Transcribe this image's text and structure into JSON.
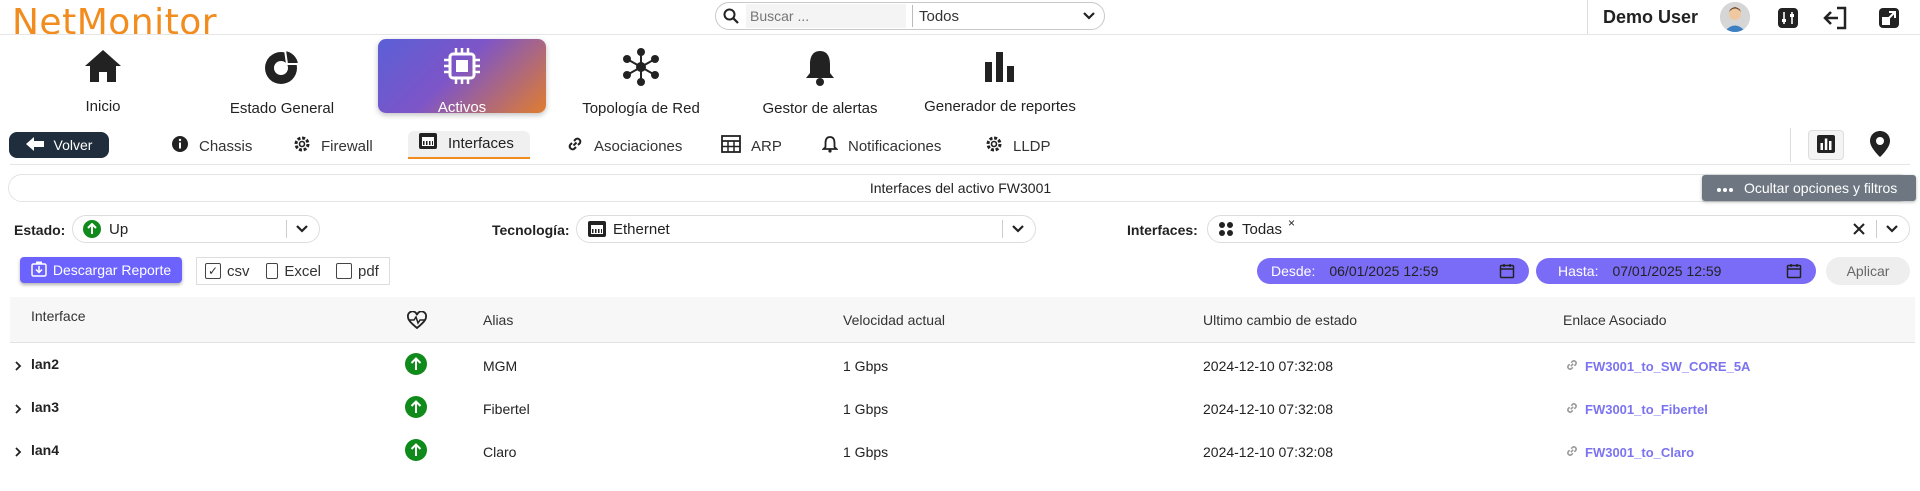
{
  "app": {
    "logo": "NetMonitor"
  },
  "search": {
    "placeholder": "Buscar ...",
    "scope": "Todos"
  },
  "user": {
    "name": "Demo User"
  },
  "nav": [
    {
      "label": "Inicio",
      "icon": "home-icon"
    },
    {
      "label": "Estado General",
      "icon": "pie-chart-icon"
    },
    {
      "label": "Activos",
      "icon": "cpu-chip-icon",
      "active": true
    },
    {
      "label": "Topología de Red",
      "icon": "network-topology-icon"
    },
    {
      "label": "Gestor de alertas",
      "icon": "bell-icon"
    },
    {
      "label": "Generador de reportes",
      "icon": "bar-chart-icon"
    }
  ],
  "subnav": {
    "back": "Volver",
    "tabs": [
      {
        "label": "Chassis",
        "icon": "info-icon"
      },
      {
        "label": "Firewall",
        "icon": "gear-icon"
      },
      {
        "label": "Interfaces",
        "icon": "ethernet-port-icon",
        "active": true
      },
      {
        "label": "Asociaciones",
        "icon": "link-icon"
      },
      {
        "label": "ARP",
        "icon": "table-icon"
      },
      {
        "label": "Notificaciones",
        "icon": "bell-icon"
      },
      {
        "label": "LLDP",
        "icon": "gear-icon"
      }
    ]
  },
  "title": "Interfaces del activo FW3001",
  "toggle_filters": "Ocultar opciones y filtros",
  "filters": {
    "estado_label": "Estado:",
    "estado_value": "Up",
    "tecnologia_label": "Tecnología:",
    "tecnologia_value": "Ethernet",
    "interfaces_label": "Interfaces:",
    "interfaces_value": "Todas",
    "remove_mark": "×"
  },
  "report": {
    "download": "Descargar Reporte",
    "formats": [
      {
        "label": "csv",
        "checked": true
      },
      {
        "label": "Excel",
        "checked": false
      },
      {
        "label": "pdf",
        "checked": false
      }
    ],
    "desde_label": "Desde:",
    "desde_value": "06/01/2025  12:59",
    "hasta_label": "Hasta:",
    "hasta_value": "07/01/2025  12:59",
    "apply": "Aplicar"
  },
  "table": {
    "headers": {
      "interface": "Interface",
      "alias": "Alias",
      "speed": "Velocidad actual",
      "last_change": "Ultimo cambio de estado",
      "link": "Enlace Asociado"
    },
    "rows": [
      {
        "interface": "lan2",
        "alias": "MGM",
        "speed": "1 Gbps",
        "last_change": "2024-12-10 07:32:08",
        "link": "FW3001_to_SW_CORE_5A"
      },
      {
        "interface": "lan3",
        "alias": "Fibertel",
        "speed": "1 Gbps",
        "last_change": "2024-12-10 07:32:08",
        "link": "FW3001_to_Fibertel"
      },
      {
        "interface": "lan4",
        "alias": "Claro",
        "speed": "1 Gbps",
        "last_change": "2024-12-10 07:32:08",
        "link": "FW3001_to_Claro"
      }
    ]
  },
  "colors": {
    "brand": "#f28c1e",
    "accent": "#6c63ff",
    "status_up": "#108a1a",
    "dark": "#1f2d3d"
  }
}
